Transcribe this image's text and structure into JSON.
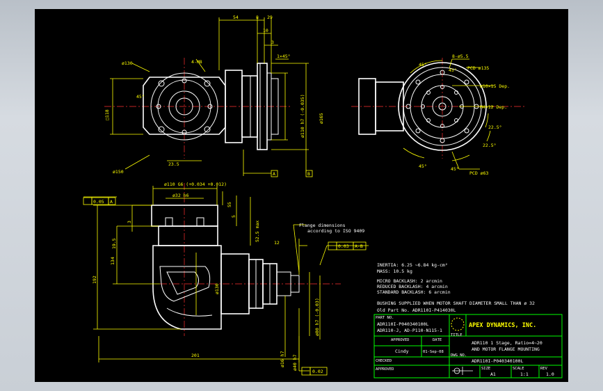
{
  "colors": {
    "background": "#000000",
    "outline": "#ffffff",
    "dimension": "#ffff00",
    "centerline": "#ff3030",
    "title_block": "#00ff00",
    "viewport_frame": "#c8ced5"
  },
  "dims": {
    "d130_top": "ø130",
    "thread": "4-M8",
    "d54": "54",
    "d8": "8",
    "d29": "29",
    "d10": "10",
    "d3": "3",
    "chamfer": "1×45°",
    "sq118": "□118",
    "d235": "23.5",
    "d150": "ø150",
    "d45a": "45°",
    "d110h7": "ø110 h7 (-0.035)",
    "d165": "ø165",
    "d45b": "45°",
    "d45c": "45°",
    "d45d": "45°",
    "d45e": "45°",
    "h55": "8-ø5.5",
    "pcd135": "PCD ø135",
    "d10x15": "ø10×15 Dep.",
    "m4": "M4×12 Dep.",
    "a225a": "22.5°",
    "a225b": "22.5°",
    "pcd63": "PCD ø63",
    "d110g6": "ø110 G6 (+0.034 +0.012)",
    "d32": "ø32 h6",
    "d55": "55",
    "d5": "5",
    "d525": "52.5 max",
    "d12": "12",
    "d195": "19.5",
    "d134": "134",
    "d192": "192",
    "d130s": "ø130",
    "d80": "ø80 h7 (-0.03)",
    "d16": "ø16 h7",
    "d40": "ø40 h7",
    "d201": "201",
    "tol_a": "0.05",
    "tol_b": "0.03",
    "tol_c": "0.02",
    "ref_a": "A",
    "ref_b": "B",
    "ref_ab": "A-B",
    "ref_a2": "A"
  },
  "notes": {
    "flange_1": "Flange dimensions",
    "flange_2": "according to ISO 9409",
    "inertia": "INERTIA: 6.25 ~6.84 kg-cm²",
    "mass": "MASS: 10.5 kg",
    "micro": "MICRO BACKLASH: 2 arcmin",
    "reduced": "REDUCED BACKLASH: 4 arcmin",
    "standard": "STANDARD BACKLASH: 6 arcmin",
    "bushing": "BUSHING SUPPLIED WHEN MOTOR SHAFT DIAMETER SMALL THAN ø 32",
    "old_part": "Old Part No. ADR110I-P414030L"
  },
  "title_block": {
    "part_no_label": "PART NO.",
    "part_no_1": "ADR110I-P040340100L",
    "part_no_2": "ADR110-J, AD-P110-N115-1",
    "title_label": "TITLE",
    "approved_label": "APPROVED",
    "date_label": "DATE",
    "drawn_by": "Cindy",
    "date_value": "01-Sep-08",
    "checked_label": "CHECKED",
    "dwg_label": "DWG NO.",
    "approved2_label": "APPROVED",
    "company": "APEX DYNAMICS, INC.",
    "title_1": "ADR110 1 Stage, Ratio=4~20",
    "title_2": "AND MOTOR FLANGE MOUNTING",
    "dwg_no": "ADR110I-P040340100L",
    "size_label": "SIZE",
    "size": "A1",
    "scale_label": "SCALE",
    "scale": "1:1",
    "rev_label": "REV",
    "rev": "1.0"
  }
}
